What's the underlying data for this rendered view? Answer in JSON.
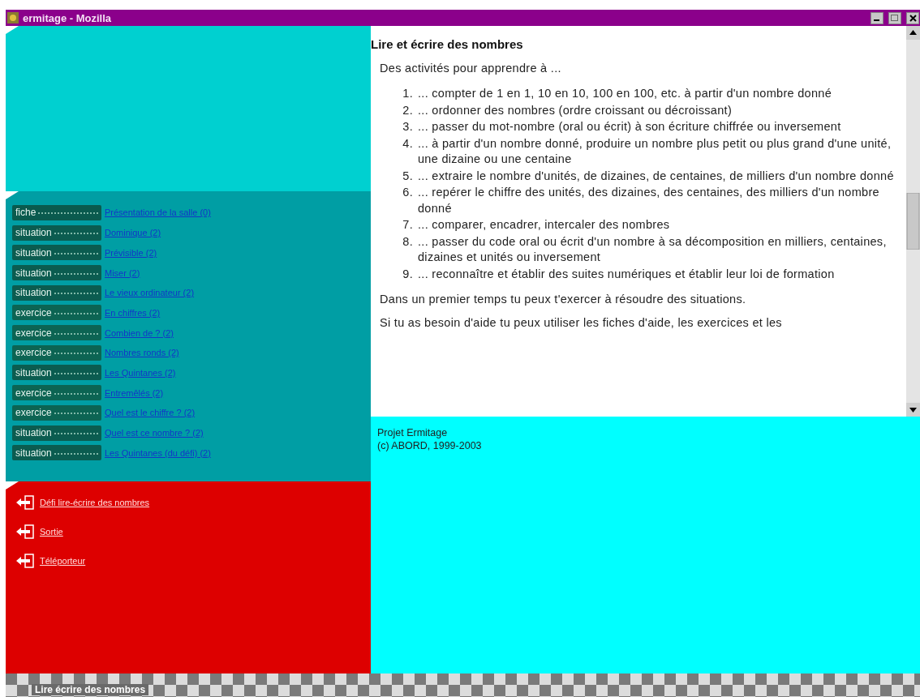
{
  "window": {
    "title": "ermitage - Mozilla"
  },
  "activities": [
    {
      "kind": "fiche",
      "label": "fiche",
      "link": "Présentation de la salle (0)"
    },
    {
      "kind": "situation",
      "label": "situation",
      "link": "Dominique (2)"
    },
    {
      "kind": "situation",
      "label": "situation",
      "link": "Prévisible (2)"
    },
    {
      "kind": "situation",
      "label": "situation",
      "link": "Miser (2)"
    },
    {
      "kind": "situation",
      "label": "situation",
      "link": "Le vieux ordinateur (2)"
    },
    {
      "kind": "exercice",
      "label": "exercice",
      "link": "En chiffres (2)"
    },
    {
      "kind": "exercice",
      "label": "exercice",
      "link": "Combien de ? (2)"
    },
    {
      "kind": "exercice",
      "label": "exercice",
      "link": "Nombres ronds (2)"
    },
    {
      "kind": "situation",
      "label": "situation",
      "link": "Les Quintanes (2)"
    },
    {
      "kind": "exercice",
      "label": "exercice",
      "link": "Entremêlés (2)"
    },
    {
      "kind": "exercice",
      "label": "exercice",
      "link": "Quel est le chiffre ? (2)"
    },
    {
      "kind": "situation",
      "label": "situation",
      "link": "Quel est ce nombre ? (2)"
    },
    {
      "kind": "situation",
      "label": "situation",
      "link": "Les Quintanes (du défi) (2)"
    }
  ],
  "navigation": [
    "Défi lire-écrire des nombres",
    "Sortie",
    "Téléporteur"
  ],
  "content": {
    "title": "Lire et écrire des nombres",
    "intro": "Des activités pour apprendre à ...",
    "items": [
      {
        "number": "1.",
        "text": "... compter de 1 en 1, 10 en 10, 100 en 100, etc. à partir d'un nombre donné"
      },
      {
        "number": "2.",
        "text": "... ordonner des nombres (ordre croissant ou décroissant)"
      },
      {
        "number": "3.",
        "text": "... passer du mot-nombre (oral ou écrit) à son écriture chiffrée ou inversement"
      },
      {
        "number": "4.",
        "text": "... à partir d'un nombre donné, produire un nombre plus petit ou plus grand d'une unité, une dizaine ou une centaine"
      },
      {
        "number": "5.",
        "text": "... extraire le nombre d'unités, de dizaines, de centaines, de milliers d'un nombre donné"
      },
      {
        "number": "6.",
        "text": "... repérer le chiffre des unités, des dizaines, des centaines, des milliers d'un nombre donné"
      },
      {
        "number": "7.",
        "text": "... comparer, encadrer, intercaler des nombres"
      },
      {
        "number": "8.",
        "text": "... passer du code oral ou écrit d'un nombre à sa décomposition en milliers, centaines, dizaines et unités ou inversement"
      },
      {
        "number": "9.",
        "text": "... reconnaître et établir des suites numériques et établir leur loi de formation"
      }
    ],
    "paragraphs": [
      "Dans un premier temps tu peux t'exercer à résoudre des situations.",
      "Si tu as besoin d'aide tu peux utiliser les fiches d'aide, les exercices et les"
    ]
  },
  "footer": {
    "lines": [
      "Projet Ermitage",
      "(c) ABORD, 1999-2003"
    ]
  },
  "status_bar": {
    "text": "Lire écrire des nombres"
  }
}
